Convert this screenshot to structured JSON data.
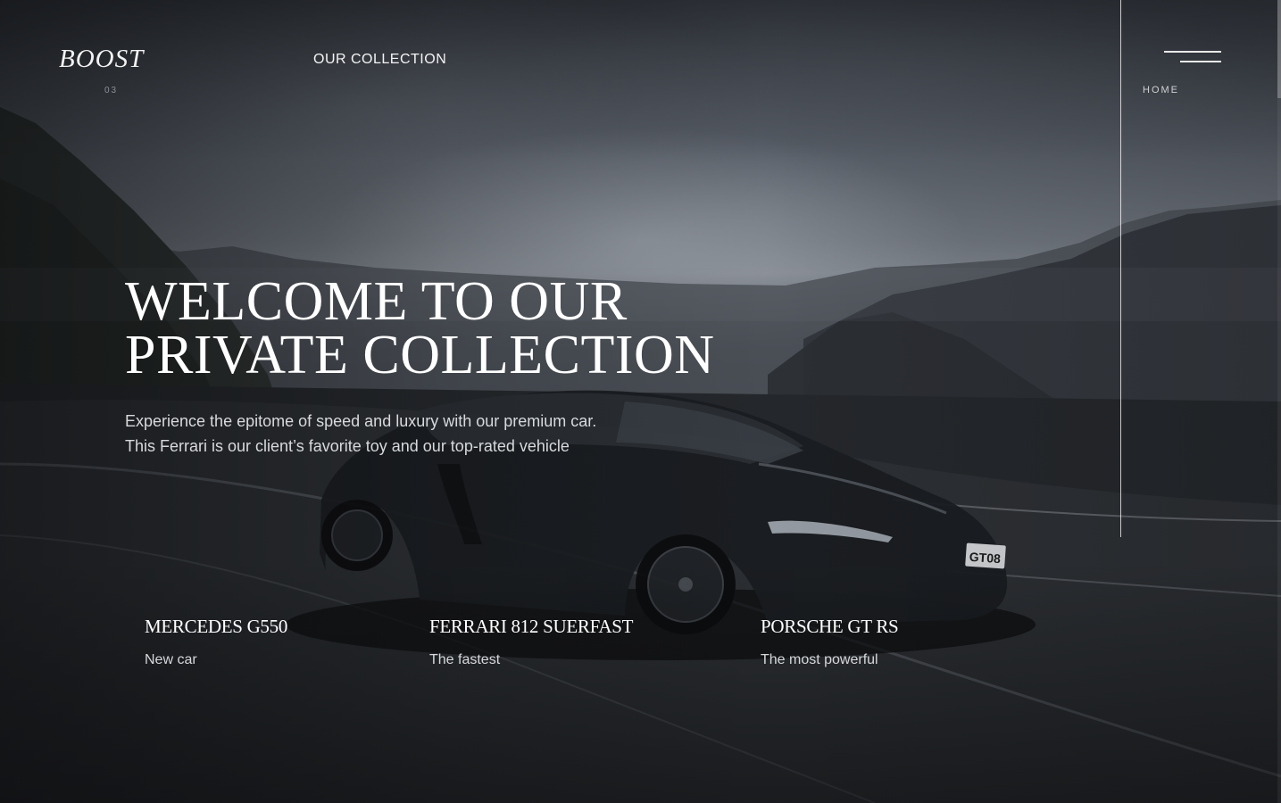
{
  "header": {
    "logo_text": "BOOST",
    "slide_index": "03",
    "nav_collection_label": "OUR COLLECTION",
    "nav_home_label": "HOME",
    "menu_icon": "hamburger-icon"
  },
  "hero": {
    "title_line1": "WELCOME TO OUR",
    "title_line2": "PRIVATE COLLECTION",
    "description_line1": "Experience the epitome of speed and luxury with our premium car.",
    "description_line2": "This Ferrari is our client’s favorite toy and our top-rated vehicle"
  },
  "cars": [
    {
      "name": "MERCEDES G550",
      "tag": "New car"
    },
    {
      "name": "FERRARI 812 SUERFAST",
      "tag": "The fastest"
    },
    {
      "name": "PORSCHE GT RS",
      "tag": "The most powerful"
    }
  ],
  "background": {
    "license_plate": "GT08"
  },
  "colors": {
    "text_primary": "#ffffff",
    "text_secondary": "#d7d9dc",
    "text_muted": "#8c9096",
    "background_dark": "#1b1d21"
  }
}
